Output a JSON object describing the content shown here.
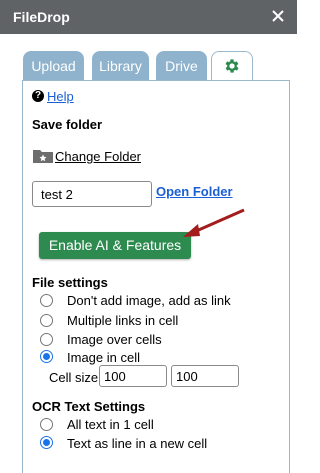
{
  "window": {
    "title": "FileDrop"
  },
  "tabs": [
    {
      "label": "Upload"
    },
    {
      "label": "Library"
    },
    {
      "label": "Drive"
    },
    {
      "label": "",
      "icon": "gear-icon"
    }
  ],
  "help": {
    "label": "Help"
  },
  "save_folder": {
    "heading": "Save folder",
    "change_label": "Change Folder",
    "folder_value": "test 2",
    "open_label": "Open Folder"
  },
  "enable_button": {
    "label": "Enable AI & Features"
  },
  "file_settings": {
    "heading": "File settings",
    "options": [
      {
        "label": "Don't add image, add as link",
        "checked": false
      },
      {
        "label": "Multiple links in cell",
        "checked": false
      },
      {
        "label": "Image over cells",
        "checked": false
      },
      {
        "label": "Image in cell",
        "checked": true
      }
    ],
    "cell_size": {
      "label": "Cell size:",
      "width": "100",
      "height": "100"
    }
  },
  "ocr_settings": {
    "heading": "OCR Text Settings",
    "options": [
      {
        "label": "All text in 1 cell",
        "checked": false
      },
      {
        "label": "Text as line in a new cell",
        "checked": true
      }
    ]
  },
  "colors": {
    "titlebar": "#5f6366",
    "tab": "#8fb2cd",
    "accent_button": "#2e8b50",
    "link": "#1a5fd6",
    "arrow": "#a31d1d"
  }
}
